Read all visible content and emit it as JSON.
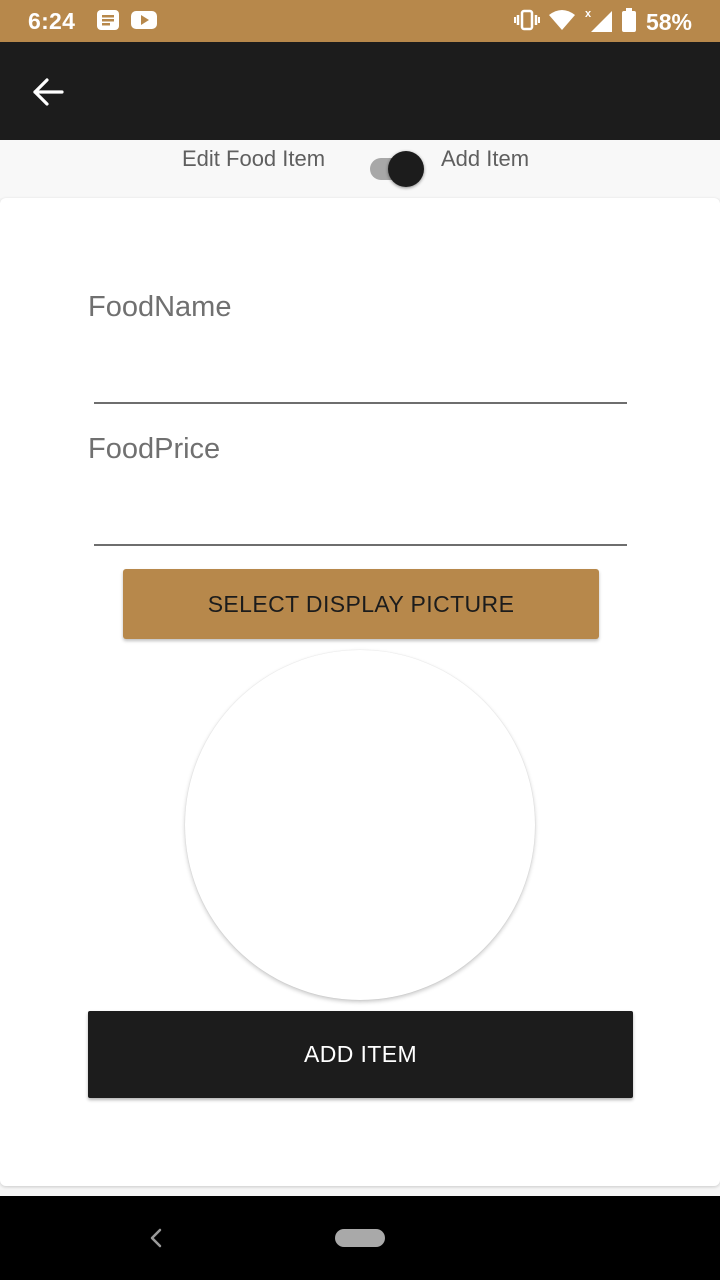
{
  "status_bar": {
    "time": "6:24",
    "battery": "58%",
    "icons": [
      "notes-icon",
      "youtube-icon",
      "vibrate-icon",
      "wifi-icon",
      "signal-icon",
      "battery-icon"
    ]
  },
  "app_bar": {
    "back_icon": "arrow-back-icon"
  },
  "mode_toggle": {
    "left_label": "Edit Food Item",
    "right_label": "Add Item",
    "state": "on"
  },
  "form": {
    "food_name": {
      "label": "FoodName",
      "value": ""
    },
    "food_price": {
      "label": "FoodPrice",
      "value": ""
    },
    "select_picture_label": "SELECT DISPLAY PICTURE",
    "submit_label": "ADD ITEM"
  },
  "nav_bar": {
    "back_icon": "nav-back-icon",
    "home_icon": "nav-home-pill-icon"
  },
  "colors": {
    "accent": "#b7884b",
    "dark": "#1c1c1c",
    "surface": "#ffffff"
  }
}
